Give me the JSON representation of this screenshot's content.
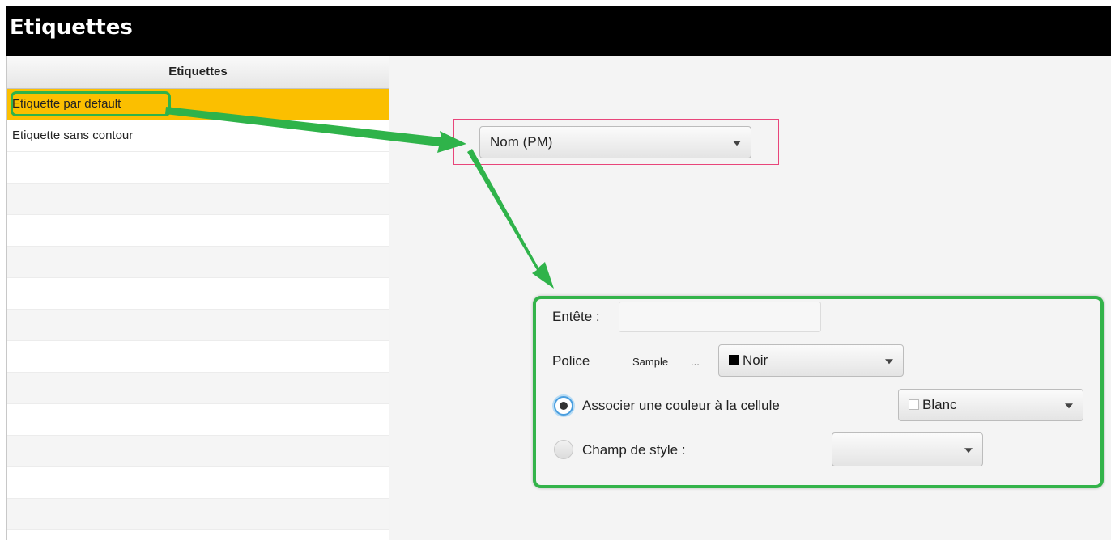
{
  "window": {
    "title": "Etiquettes"
  },
  "sidebar": {
    "header": "Etiquettes",
    "items": [
      {
        "label": "Etiquette par default",
        "selected": true
      },
      {
        "label": "Etiquette sans contour",
        "selected": false
      }
    ]
  },
  "main": {
    "field_combo": {
      "value": "Nom (PM)"
    },
    "form": {
      "header_label": "Entête :",
      "header_value": "",
      "police_label": "Police",
      "sample_label": "Sample",
      "ellipsis_label": "...",
      "font_color": {
        "value": "Noir",
        "swatch": "#000000"
      },
      "associate_radio": {
        "label": "Associer une couleur à la cellule",
        "checked": true
      },
      "cell_color": {
        "value": "Blanc",
        "swatch": "#ffffff"
      },
      "style_radio": {
        "label": "Champ de style :",
        "checked": false
      },
      "style_field": {
        "value": ""
      }
    }
  },
  "colors": {
    "selection": "#fbbf00",
    "highlight": "#2fb34a",
    "focus_box": "#e8457a",
    "title_bar": "#000000"
  },
  "icons": [
    "chevron-down-icon",
    "green-annotation-arrow"
  ]
}
